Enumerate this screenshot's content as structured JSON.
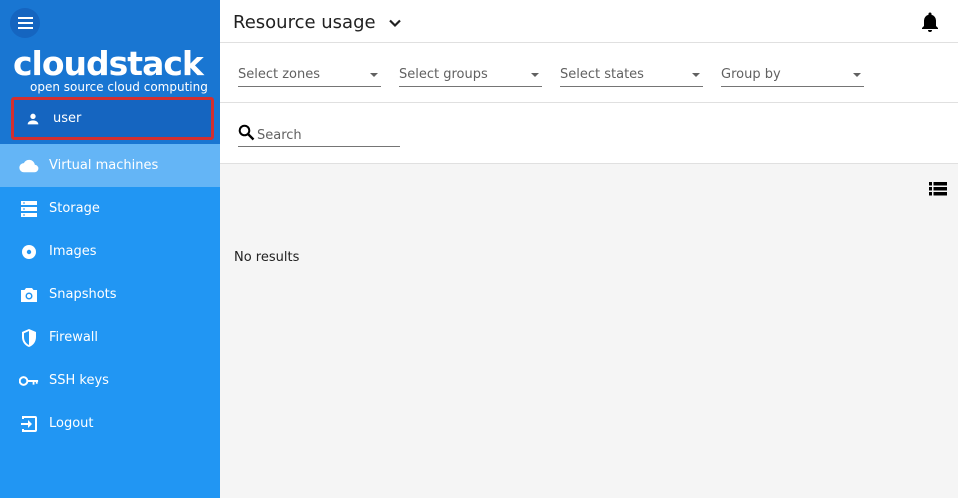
{
  "sidebar": {
    "brand": {
      "name": "cloudstack",
      "tagline": "open source cloud computing"
    },
    "user": {
      "label": "user",
      "icon": "person-icon"
    },
    "items": [
      {
        "label": "Virtual machines",
        "icon": "cloud-icon",
        "active": true
      },
      {
        "label": "Storage",
        "icon": "storage-icon"
      },
      {
        "label": "Images",
        "icon": "disc-icon"
      },
      {
        "label": "Snapshots",
        "icon": "camera-icon"
      },
      {
        "label": "Firewall",
        "icon": "shield-icon"
      },
      {
        "label": "SSH keys",
        "icon": "key-icon"
      },
      {
        "label": "Logout",
        "icon": "logout-icon"
      }
    ],
    "colors": {
      "background": "#2196f3",
      "header": "#1976d2",
      "active": "#64b5f6",
      "highlight_border": "#d32f2f"
    }
  },
  "header": {
    "title": "Resource usage"
  },
  "filters": {
    "zones": "Select zones",
    "groups": "Select groups",
    "states": "Select states",
    "group_by": "Group by"
  },
  "search": {
    "placeholder": "Search"
  },
  "content": {
    "empty_message": "No results"
  }
}
